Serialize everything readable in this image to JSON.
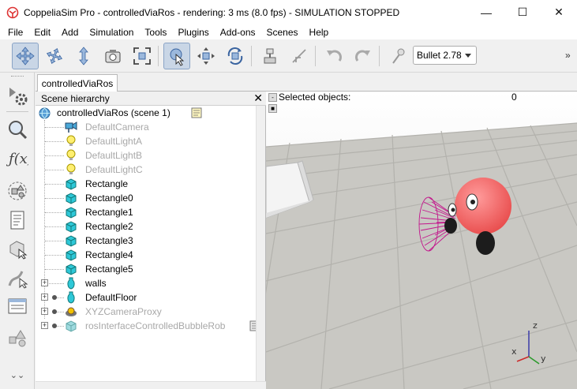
{
  "window": {
    "title": "CoppeliaSim Pro - controlledViaRos - rendering: 3 ms (8.0 fps) - SIMULATION STOPPED",
    "minimize": "—",
    "maximize": "☐",
    "close": "✕"
  },
  "menu": [
    "File",
    "Edit",
    "Add",
    "Simulation",
    "Tools",
    "Plugins",
    "Add-ons",
    "Scenes",
    "Help"
  ],
  "toolbar": {
    "engine_selected": "Bullet 2.78",
    "overflow": "»",
    "buttons": [
      {
        "name": "camera-pan-icon",
        "active": false
      },
      {
        "name": "camera-rotate-icon",
        "active": false
      },
      {
        "name": "camera-shift-icon",
        "active": false
      },
      {
        "name": "camera-angle-icon",
        "active": false
      },
      {
        "name": "fit-to-view-icon",
        "active": false
      },
      {
        "name": "click-selection-icon",
        "active": true
      },
      {
        "name": "object-shift-icon",
        "active": false
      },
      {
        "name": "object-rotate-icon",
        "active": false
      },
      {
        "name": "assemble-icon",
        "active": false
      },
      {
        "name": "transfer-dna-icon",
        "active": false
      },
      {
        "name": "undo-icon",
        "active": false
      },
      {
        "name": "redo-icon",
        "active": false
      },
      {
        "name": "dynamics-icon",
        "active": false
      }
    ]
  },
  "sidebar": {
    "tools": [
      "simulation-settings-icon",
      "model-browser-icon",
      "calculation-modules-icon",
      "collections-icon",
      "scripts-icon",
      "shape-edit-icon",
      "path-edit-icon",
      "selection-icon",
      "layers-icon"
    ],
    "expand": "⌄⌄"
  },
  "tabs": [
    {
      "label": "controlledViaRos"
    }
  ],
  "hierarchy": {
    "title": "Scene hierarchy",
    "close": "✕",
    "root": "controlledViaRos (scene 1)",
    "items": [
      {
        "label": "DefaultCamera",
        "type": "camera",
        "dim": true
      },
      {
        "label": "DefaultLightA",
        "type": "light",
        "dim": true
      },
      {
        "label": "DefaultLightB",
        "type": "light",
        "dim": true
      },
      {
        "label": "DefaultLightC",
        "type": "light",
        "dim": true
      },
      {
        "label": "Rectangle",
        "type": "shape",
        "dim": false
      },
      {
        "label": "Rectangle0",
        "type": "shape",
        "dim": false
      },
      {
        "label": "Rectangle1",
        "type": "shape",
        "dim": false
      },
      {
        "label": "Rectangle2",
        "type": "shape",
        "dim": false
      },
      {
        "label": "Rectangle3",
        "type": "shape",
        "dim": false
      },
      {
        "label": "Rectangle4",
        "type": "shape",
        "dim": false
      },
      {
        "label": "Rectangle5",
        "type": "shape",
        "dim": false
      },
      {
        "label": "walls",
        "type": "bottle",
        "dim": false
      },
      {
        "label": "DefaultFloor",
        "type": "bottle",
        "dim": false
      },
      {
        "label": "XYZCameraProxy",
        "type": "proxy",
        "dim": true
      },
      {
        "label": "rosInterfaceControlledBubbleRob",
        "type": "shape",
        "dim": true
      }
    ]
  },
  "viewport": {
    "selected_label": "Selected objects:",
    "selected_count": "0",
    "axes": {
      "x": "x",
      "y": "y",
      "z": "z"
    },
    "colors": {
      "sky_top": "#f4f4f4",
      "floor": "#c8c8c4",
      "robot_body": "#ff6a6a",
      "sensor": "#c3168c"
    }
  }
}
